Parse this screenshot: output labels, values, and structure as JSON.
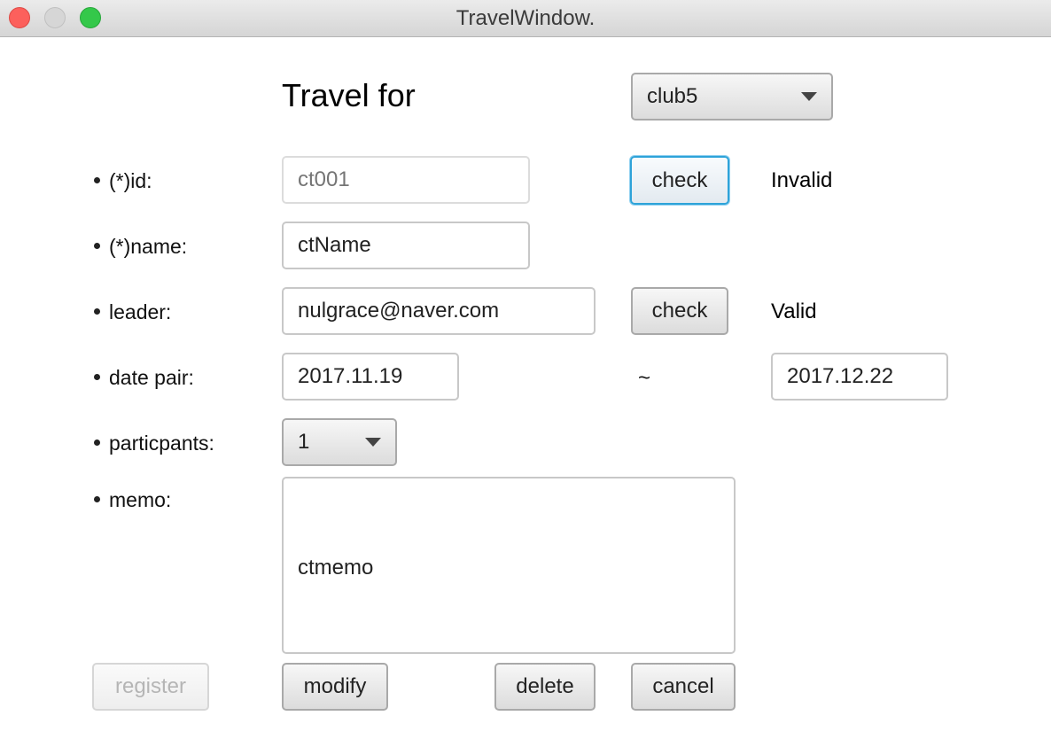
{
  "window": {
    "title": "TravelWindow.",
    "controls": [
      "close-icon",
      "minimize-icon",
      "maximize-icon"
    ]
  },
  "header": {
    "title": "Travel for",
    "club_select": {
      "value": "club5",
      "icon": "chevron-down-icon"
    }
  },
  "form": {
    "id": {
      "label": "(*)id:",
      "placeholder": "ct001",
      "check_label": "check",
      "status": "Invalid"
    },
    "name": {
      "label": "(*)name:",
      "value": "ctName"
    },
    "leader": {
      "label": "leader:",
      "value": "nulgrace@naver.com",
      "check_label": "check",
      "status": "Valid"
    },
    "date_pair": {
      "label": "date pair:",
      "start": "2017.11.19",
      "separator": "~",
      "end": "2017.12.22"
    },
    "participants": {
      "label": "particpants:",
      "value": "1",
      "icon": "chevron-down-icon"
    },
    "memo": {
      "label": "memo:",
      "value": "ctmemo"
    }
  },
  "actions": {
    "register": "register",
    "modify": "modify",
    "delete": "delete",
    "cancel": "cancel"
  },
  "colors": {
    "focus_ring": "#2ea3d9",
    "close": "#fc605c",
    "maximize": "#34c84a",
    "minimize_disabled": "#d6d6d6"
  }
}
